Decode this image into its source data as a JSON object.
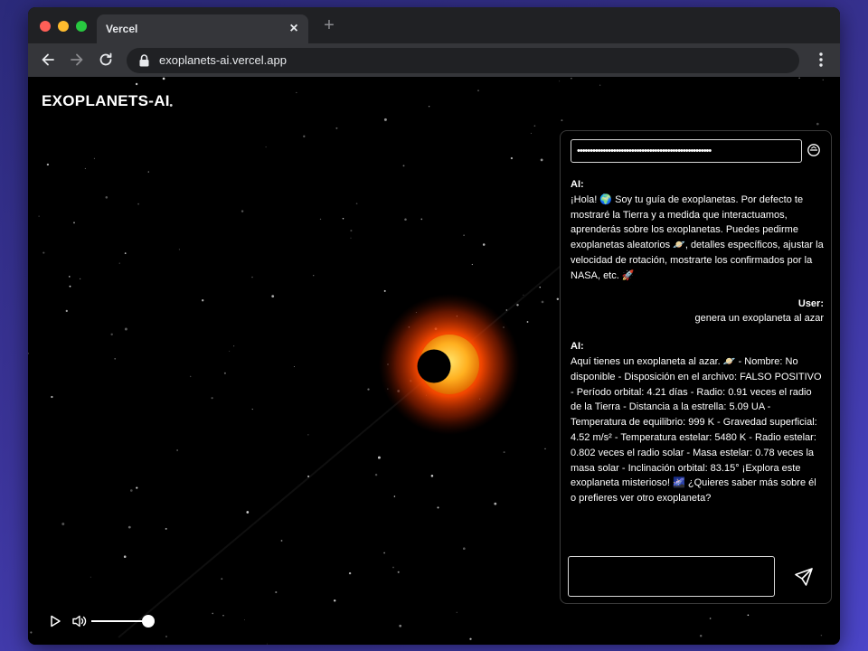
{
  "browser": {
    "tab_title": "Vercel",
    "tab_close": "×",
    "new_tab": "+",
    "url": "exoplanets-ai.vercel.app"
  },
  "app": {
    "brand": "EXOPLANETS-AI"
  },
  "chat": {
    "api_key_value": "••••••••••••••••••••••••••••••••••••••••••••••••••••",
    "messages": [
      {
        "sender": "AI:",
        "text": "¡Hola! 🌍 Soy tu guía de exoplanetas. Por defecto te mostraré la Tierra y a medida que interactuamos, aprenderás sobre los exoplanetas. Puedes pedirme exoplanetas aleatorios 🪐, detalles específicos, ajustar la velocidad de rotación, mostrarte los confirmados por la NASA, etc. 🚀"
      },
      {
        "sender": "User:",
        "text": "genera un exoplaneta al azar"
      },
      {
        "sender": "AI:",
        "text": "Aquí tienes un exoplaneta al azar. 🪐 - Nombre: No disponible - Disposición en el archivo: FALSO POSITIVO - Período orbital: 4.21 días - Radio: 0.91 veces el radio de la Tierra - Distancia a la estrella: 5.09 UA - Temperatura de equilibrio: 999 K - Gravedad superficial: 4.52 m/s² - Temperatura estelar: 5480 K - Radio estelar: 0.802 veces el radio solar - Masa estelar: 0.78 veces la masa solar - Inclinación orbital: 83.15° ¡Explora este exoplaneta misterioso! 🌌 ¿Quieres saber más sobre él o prefieres ver otro exoplaneta?"
      }
    ],
    "reply_value": ""
  },
  "media": {
    "volume_level": 1.0
  },
  "colors": {
    "star_core": "#ffb020",
    "star_glow": "#ff4a00",
    "page_bg": "#000000",
    "desktop_bg": "#3a3396"
  }
}
